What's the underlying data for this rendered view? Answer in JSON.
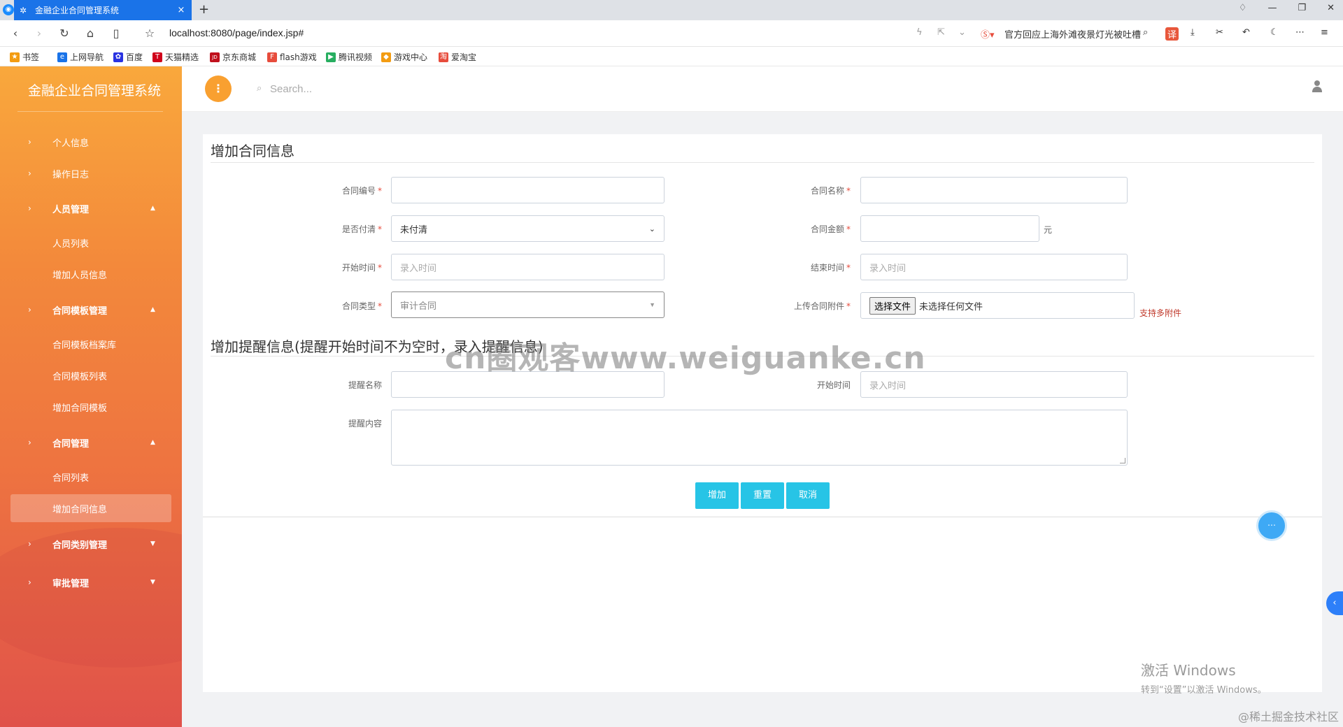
{
  "browser": {
    "tab_title": "金融企业合同管理系统",
    "tab_close": "×",
    "new_tab": "+",
    "url": "localhost:8080/page/index.jsp#",
    "news_text": "官方回应上海外滩夜景灯光被吐槽",
    "translate_badge": "译",
    "bookmarks": [
      {
        "label": "书签",
        "icon": "star-icon",
        "color": "#f39c12"
      },
      {
        "label": "上网导航",
        "icon": "e-icon",
        "color": "#1a73e8"
      },
      {
        "label": "百度",
        "icon": "paw-icon",
        "color": "#2932e1"
      },
      {
        "label": "天猫精选",
        "icon": "T-icon",
        "color": "#d0021b"
      },
      {
        "label": "京东商城",
        "icon": "JD-icon",
        "color": "#c0101c"
      },
      {
        "label": "flash游戏",
        "icon": "flash-icon",
        "color": "#e74c3c"
      },
      {
        "label": "腾讯视频",
        "icon": "play-icon",
        "color": "#27ae60"
      },
      {
        "label": "游戏中心",
        "icon": "gamepad-icon",
        "color": "#f39c12"
      },
      {
        "label": "爱淘宝",
        "icon": "taobao-icon",
        "color": "#e74c3c"
      }
    ]
  },
  "sidebar": {
    "brand": "金融企业合同管理系统",
    "items": [
      {
        "label": "个人信息",
        "type": "top"
      },
      {
        "label": "操作日志",
        "type": "top"
      },
      {
        "label": "人员管理",
        "type": "group"
      },
      {
        "label": "人员列表",
        "type": "sub"
      },
      {
        "label": "增加人员信息",
        "type": "sub"
      },
      {
        "label": "合同模板管理",
        "type": "group"
      },
      {
        "label": "合同模板档案库",
        "type": "sub"
      },
      {
        "label": "合同模板列表",
        "type": "sub"
      },
      {
        "label": "增加合同模板",
        "type": "sub"
      },
      {
        "label": "合同管理",
        "type": "group"
      },
      {
        "label": "合同列表",
        "type": "sub"
      },
      {
        "label": "增加合同信息",
        "type": "sub",
        "active": true
      },
      {
        "label": "合同类别管理",
        "type": "group"
      },
      {
        "label": "审批管理",
        "type": "group"
      }
    ]
  },
  "header": {
    "search_placeholder": "Search..."
  },
  "form": {
    "section1_title": "增加合同信息",
    "section2_title": "增加提醒信息(提醒开始时间不为空时，录入提醒信息)",
    "required_mark": "*",
    "contract_no_label": "合同编号",
    "contract_name_label": "合同名称",
    "paid_label": "是否付清",
    "paid_value": "未付清",
    "amount_label": "合同金额",
    "amount_unit": "元",
    "start_label": "开始时间",
    "start_placeholder": "录入时间",
    "end_label": "结束时间",
    "end_placeholder": "录入时间",
    "type_label": "合同类型",
    "type_value": "审计合同",
    "attach_label": "上传合同附件",
    "file_button": "选择文件",
    "file_status": "未选择任何文件",
    "attach_hint": "支持多附件",
    "remind_name_label": "提醒名称",
    "remind_start_label": "开始时间",
    "remind_start_placeholder": "录入时间",
    "remind_content_label": "提醒内容",
    "buttons": {
      "add": "增加",
      "reset": "重置",
      "cancel": "取消"
    }
  },
  "overlays": {
    "watermark": "cn圈观客www.weiguanke.cn",
    "activate_title": "激活 Windows",
    "activate_sub": "转到“设置”以激活 Windows。",
    "credit": "@稀土掘金技术社区"
  }
}
